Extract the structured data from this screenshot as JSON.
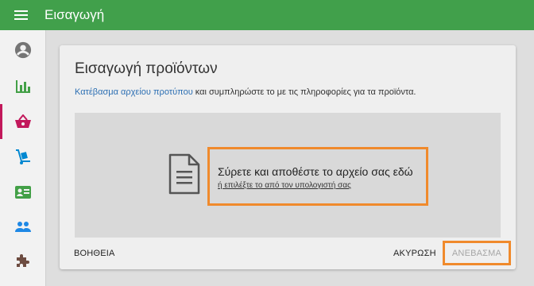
{
  "app": {
    "title": "Εισαγωγή"
  },
  "sidebar": {
    "items": [
      {
        "name": "account",
        "icon": "account-circle-icon",
        "active": false
      },
      {
        "name": "stats",
        "icon": "bar-chart-icon",
        "active": false
      },
      {
        "name": "products",
        "icon": "shopping-basket-icon",
        "active": true
      },
      {
        "name": "orders",
        "icon": "dolly-cart-icon",
        "active": false
      },
      {
        "name": "contacts",
        "icon": "contact-card-icon",
        "active": false
      },
      {
        "name": "users",
        "icon": "people-icon",
        "active": false
      },
      {
        "name": "extensions",
        "icon": "puzzle-icon",
        "active": false
      }
    ]
  },
  "dialog": {
    "title": "Εισαγωγή προϊόντων",
    "template_link": "Κατέβασμα αρχείου προτύπου",
    "description_rest": " και συμπληρώστε το με τις πληροφορίες για τα προϊόντα.",
    "dropzone": {
      "main_text": "Σύρετε και αποθέστε το αρχείο σας εδώ",
      "sub_text": "ή επιλέξτε το από τον υπολογιστή σας"
    },
    "help_label": "ΒΟΗΘΕΙΑ",
    "cancel_label": "ΑΚΥΡΩΣΗ",
    "upload_label": "ΑΝΕΒΑΣΜΑ"
  },
  "colors": {
    "topbar": "#41a04b",
    "accent_green": "#43a047",
    "active_pink": "#c2185b",
    "link_blue": "#2c6fb3",
    "highlight_orange": "#f08a2c"
  }
}
